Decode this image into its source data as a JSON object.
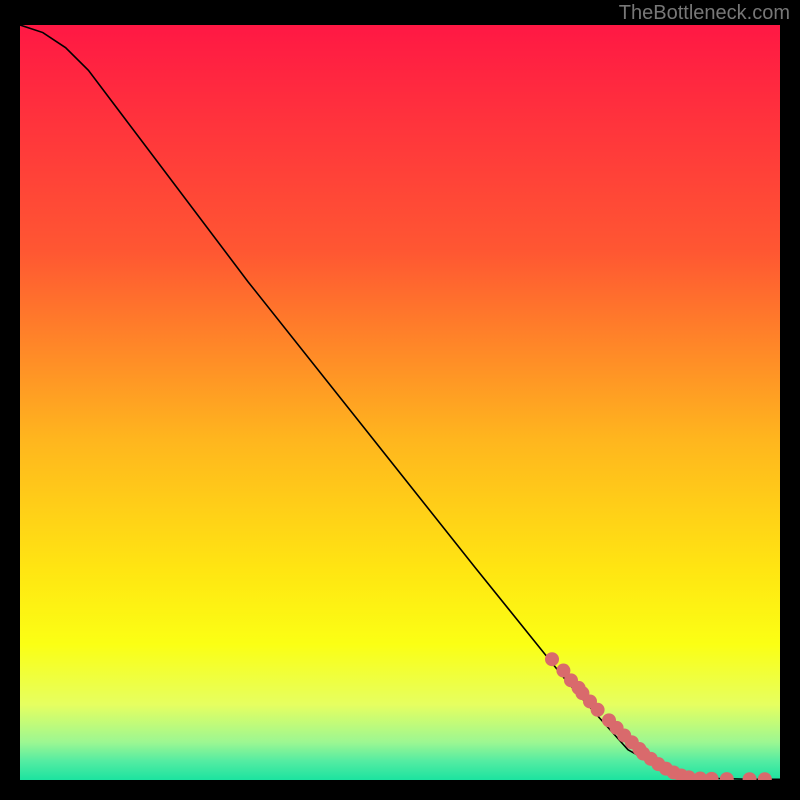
{
  "watermark": "TheBottleneck.com",
  "chart_data": {
    "type": "line",
    "title": "",
    "xlabel": "",
    "ylabel": "",
    "xlim": [
      0,
      100
    ],
    "ylim": [
      0,
      100
    ],
    "grid": false,
    "legend": false,
    "background_gradient": {
      "stops": [
        {
          "offset": 0.0,
          "color": "#ff1844"
        },
        {
          "offset": 0.3,
          "color": "#ff5732"
        },
        {
          "offset": 0.55,
          "color": "#ffb61e"
        },
        {
          "offset": 0.72,
          "color": "#ffe512"
        },
        {
          "offset": 0.82,
          "color": "#fbff14"
        },
        {
          "offset": 0.9,
          "color": "#e6ff60"
        },
        {
          "offset": 0.95,
          "color": "#9cf792"
        },
        {
          "offset": 0.975,
          "color": "#54eca2"
        },
        {
          "offset": 1.0,
          "color": "#1be3a0"
        }
      ]
    },
    "series": [
      {
        "name": "curve",
        "type": "line",
        "color": "#000000",
        "x": [
          0,
          3,
          6,
          9,
          12,
          18,
          30,
          45,
          60,
          72,
          80,
          85,
          88,
          92,
          96,
          100
        ],
        "y": [
          100,
          99,
          97,
          94,
          90,
          82,
          66,
          47,
          28,
          13,
          4,
          1.2,
          0.4,
          0.2,
          0.1,
          0.1
        ]
      },
      {
        "name": "markers",
        "type": "scatter",
        "color": "#d96a6c",
        "x": [
          70,
          71.5,
          72.5,
          73.5,
          74,
          75,
          76,
          77.5,
          78.5,
          79.5,
          80.5,
          81.5,
          82,
          83,
          84,
          85,
          86,
          87,
          88,
          89.5,
          91,
          93,
          96,
          98
        ],
        "y": [
          16,
          14.5,
          13.2,
          12.2,
          11.5,
          10.4,
          9.3,
          7.9,
          6.9,
          5.9,
          5.0,
          4.1,
          3.5,
          2.8,
          2.1,
          1.5,
          1.0,
          0.6,
          0.35,
          0.2,
          0.15,
          0.12,
          0.1,
          0.1
        ]
      }
    ]
  }
}
